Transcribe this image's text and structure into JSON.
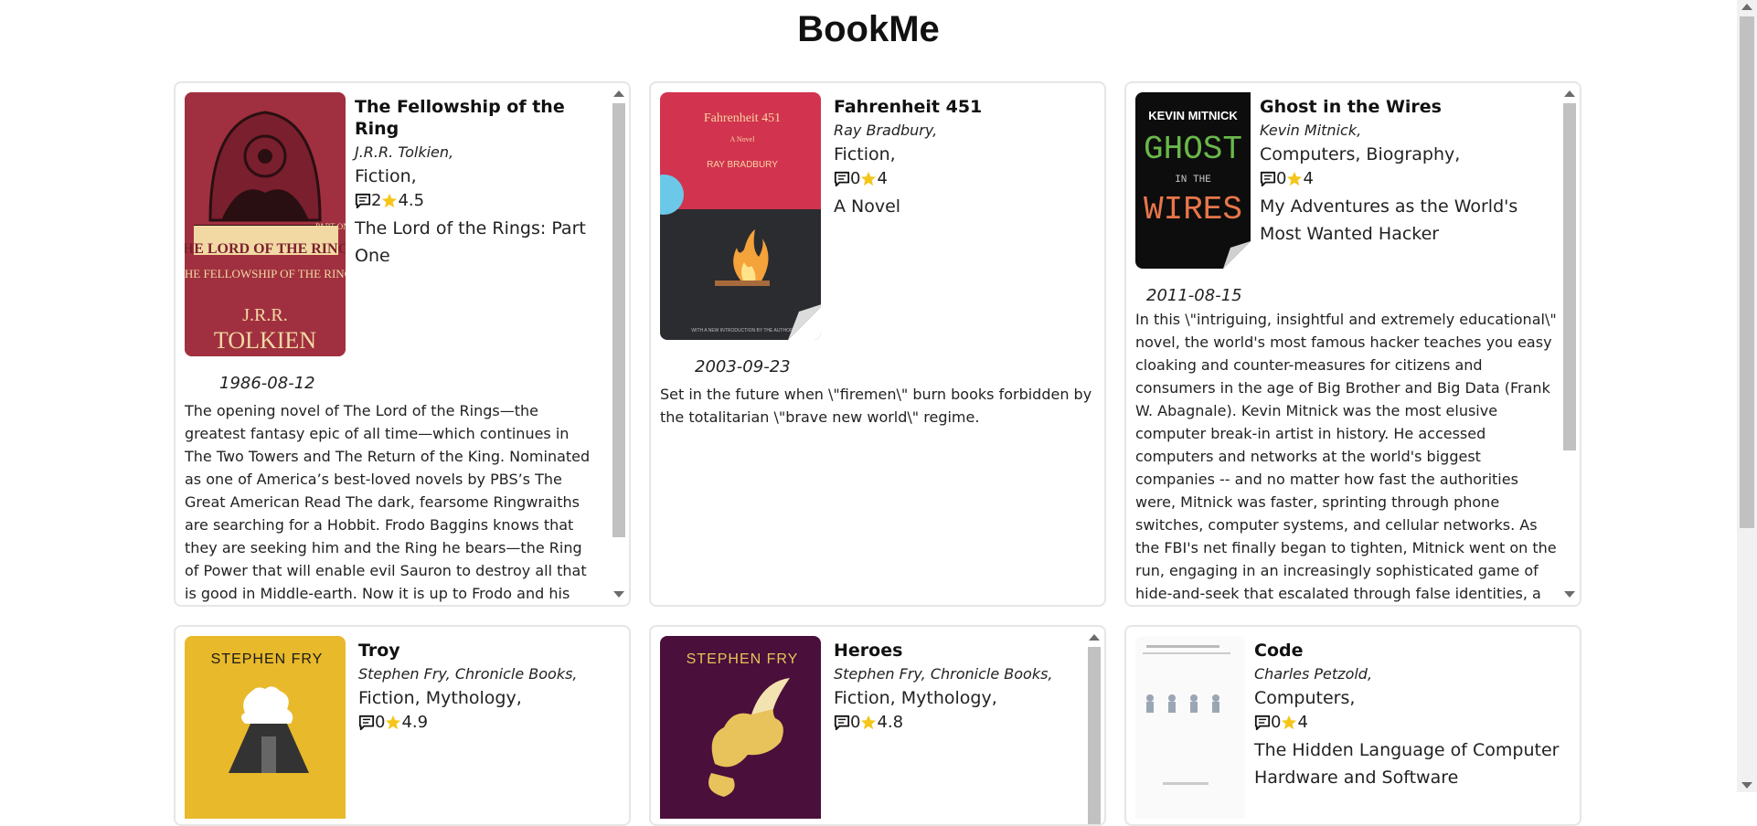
{
  "app": {
    "title": "BookMe"
  },
  "colors": {
    "star": "#f5c518",
    "border": "#e6e6e6"
  },
  "icons": {
    "comment": "comment-icon",
    "rating": "star-icon"
  },
  "books": [
    {
      "title": "The Fellowship of the Ring",
      "authors": "J.R.R. Tolkien,",
      "genres": "Fiction,",
      "comments": "2",
      "rating": "4.5",
      "subtitle": "The Lord of the Rings: Part One",
      "date": "1986-08-12",
      "description": "The opening novel of The Lord of the Rings—the greatest fantasy epic of all time—which continues in The Two Towers and The Return of the King. Nominated as one of America’s best-loved novels by PBS’s The Great American Read The dark, fearsome Ringwraiths are searching for a Hobbit. Frodo Baggins knows that they are seeking him and the Ring he bears—the Ring of Power that will enable evil Sauron to destroy all that is good in Middle-earth. Now it is up to Frodo and his faithful servant, Sam, with a small band of companions, to carry the Ring to the one",
      "cover": {
        "top_text": "PART ONE",
        "series": "THE LORD OF THE RINGS",
        "book": "THE FELLOWSHIP OF THE RING",
        "author_initials": "J.R.R.",
        "author_surname": "TOLKIEN"
      }
    },
    {
      "title": "Fahrenheit 451",
      "authors": "Ray Bradbury,",
      "genres": "Fiction,",
      "comments": "0",
      "rating": "4",
      "subtitle": "A Novel",
      "date": "2003-09-23",
      "description": "Set in the future when \\\"firemen\\\" burn books forbidden by the totalitarian \\\"brave new world\\\" regime.",
      "cover": {
        "title": "Fahrenheit 451",
        "tag": "A Novel",
        "author": "RAY BRADBURY",
        "footer": "WITH A NEW INTRODUCTION BY THE AUTHOR"
      }
    },
    {
      "title": "Ghost in the Wires",
      "authors": "Kevin Mitnick,",
      "genres": "Computers, Biography,",
      "comments": "0",
      "rating": "4",
      "subtitle": "My Adventures as the World's Most Wanted Hacker",
      "date": "2011-08-15",
      "description": "In this \\\"intriguing, insightful and extremely educational\\\" novel, the world's most famous hacker teaches you easy cloaking and counter-measures for citizens and consumers in the age of Big Brother and Big Data (Frank W. Abagnale). Kevin Mitnick was the most elusive computer break-in artist in history. He accessed computers and networks at the world's biggest companies -- and no matter how fast the authorities were, Mitnick was faster, sprinting through phone switches, computer systems, and cellular networks. As the FBI's net finally began to tighten, Mitnick went on the run, engaging in an increasingly sophisticated game of hide-and-seek that escalated through false identities, a host of cities, and plenty of close calls, to an ultimate showdown with the Feds, who",
      "cover": {
        "author": "KEVIN MITNICK",
        "word1": "GHOST",
        "word2": "IN THE",
        "word3": "WIRES"
      }
    },
    {
      "title": "Troy",
      "authors": "Stephen Fry, Chronicle Books,",
      "genres": "Fiction, Mythology,",
      "comments": "0",
      "rating": "4.9",
      "cover": {
        "author": "STEPHEN FRY"
      }
    },
    {
      "title": "Heroes",
      "authors": "Stephen Fry, Chronicle Books,",
      "genres": "Fiction, Mythology,",
      "comments": "0",
      "rating": "4.8",
      "cover": {
        "author": "STEPHEN FRY"
      }
    },
    {
      "title": "Code",
      "authors": "Charles Petzold,",
      "genres": "Computers,",
      "comments": "0",
      "rating": "4",
      "subtitle": "The Hidden Language of Computer Hardware and Software"
    }
  ]
}
